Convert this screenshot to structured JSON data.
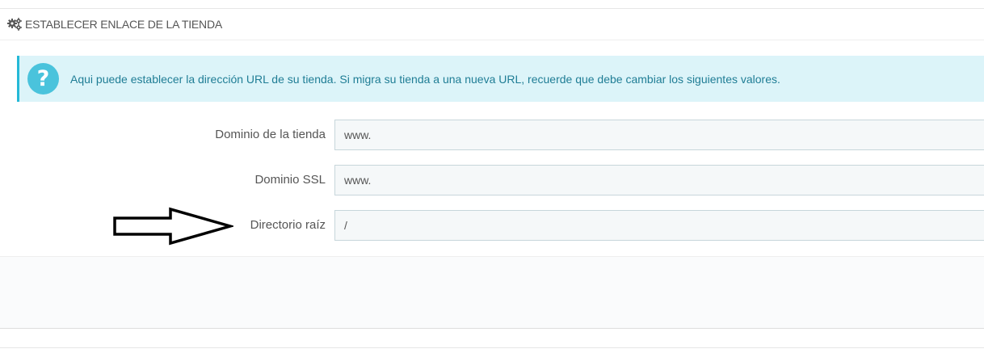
{
  "panel": {
    "title": "ESTABLECER ENLACE DE LA TIENDA",
    "title_icon": "gears-icon"
  },
  "alert": {
    "icon": "question-circle-icon",
    "icon_glyph": "?",
    "text": "Aqui puede establecer la dirección URL de su tienda. Si migra su tienda a una nueva URL, recuerde que debe cambiar los siguientes valores."
  },
  "form": {
    "shop_domain": {
      "label": "Dominio de la tienda",
      "value": "www."
    },
    "ssl_domain": {
      "label": "Dominio SSL",
      "value": "www."
    },
    "base_uri": {
      "label": "Directorio raíz",
      "value": "/"
    }
  },
  "annotation": {
    "arrow": "right-arrow-annotation"
  },
  "colors": {
    "alert_bg": "#dcf4f9",
    "alert_border": "#25b9d7",
    "alert_icon": "#4ac3dc",
    "alert_text": "#1f7d95",
    "input_bg": "#f5f8f9",
    "label_text": "#555555"
  }
}
